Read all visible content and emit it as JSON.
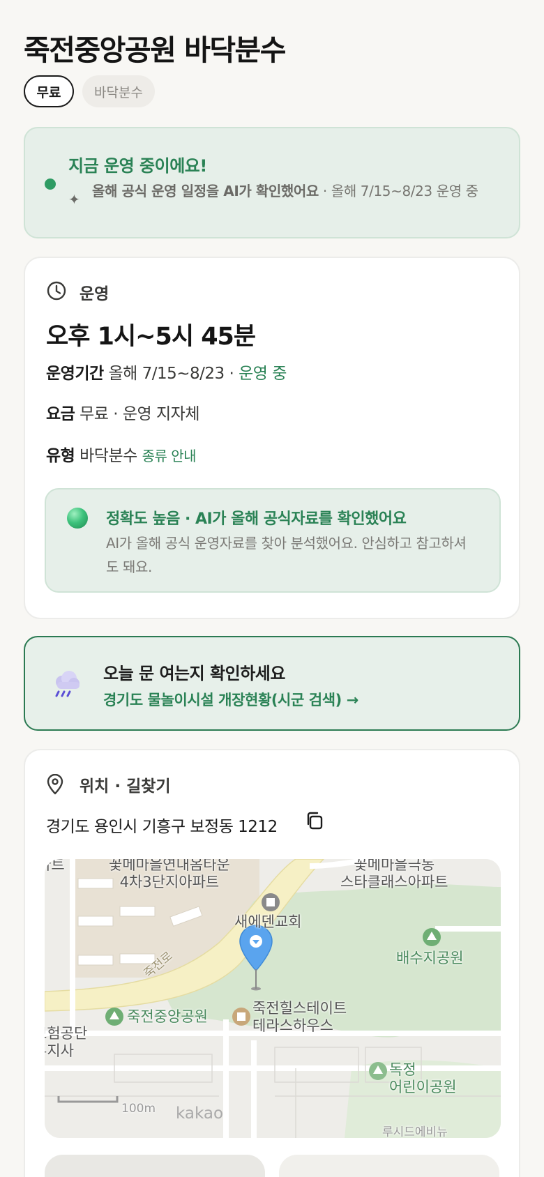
{
  "title": "죽전중앙공원 바닥분수",
  "chips": {
    "price": "무료",
    "type": "바닥분수"
  },
  "status": {
    "headline": "지금 운영 중이에요!",
    "sparkle": "✦",
    "ai_note": "올해 공식 운영 일정을 AI가 확인했어요",
    "period_note": "· 올해 7/15~8/23 운영 중"
  },
  "operation": {
    "section_label": "운영",
    "hours": "오후 1시~5시 45분",
    "period_label": "운영기간",
    "period_value": "올해 7/15~8/23 ·",
    "period_status": "운영 중",
    "fee_label": "요금",
    "fee_value": "무료 · 운영 지자체",
    "type_label": "유형",
    "type_value": "바닥분수",
    "type_link": "종류 안내"
  },
  "accuracy": {
    "title": "정확도 높음 · AI가 올해 공식자료를 확인했어요",
    "desc": "AI가 올해 공식 운영자료를 찾아 분석했어요. 안심하고 참고하셔도 돼요."
  },
  "check": {
    "title": "오늘 문 여는지 확인하세요",
    "link": "경기도 물놀이시설 개장현황(시군 검색) →"
  },
  "location": {
    "section_label": "위치 · 길찾기",
    "address": "경기도 용인시 기흥구 보정동 1212"
  },
  "map": {
    "labels": {
      "apt1": "꽃메마을연내옴타운\n4차3단지아파트",
      "apt2": "꽃메마을극동\n스타클래스아파트",
      "church": "새에덴교회",
      "park1": "배수지공원",
      "road": "죽전로",
      "park2": "죽전중앙공원",
      "house": "죽전힐스테이트\n테라스하우스",
      "corp": "보험공단\n부지사",
      "left_top": "파트",
      "park3": "독정\n어린이공원",
      "bottom_right": "루시드에비뉴",
      "scale": "100m",
      "brand": "kakao"
    }
  },
  "colors": {
    "accent_green": "#2a8255",
    "status_bg": "#e6efe9",
    "page_bg": "#f8f7f4"
  },
  "icons": {
    "clock": "clock-icon",
    "pin": "location-pin-icon",
    "copy": "copy-icon",
    "rain": "rain-cloud-icon",
    "map_marker": "map-marker-icon"
  }
}
